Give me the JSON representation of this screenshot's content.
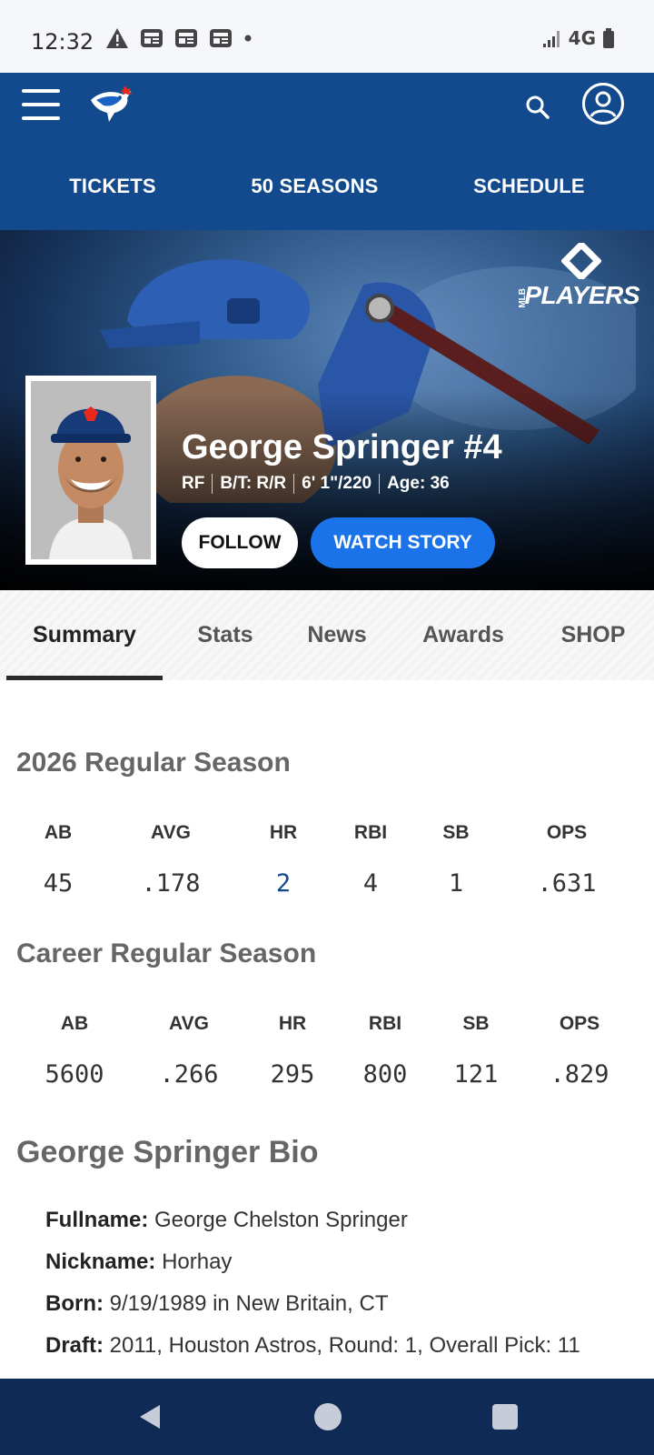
{
  "status_bar": {
    "time": "12:32",
    "network": "4G"
  },
  "header": {
    "nav": [
      {
        "label": "TICKETS"
      },
      {
        "label": "50 SEASONS"
      },
      {
        "label": "SCHEDULE"
      }
    ],
    "brand_color": "#134a8e"
  },
  "hero": {
    "badge_text": "PLAYERS",
    "badge_small": "MLB",
    "player_name": "George Springer #4",
    "meta": [
      "RF",
      "B/T: R/R",
      "6' 1\"/220",
      "Age: 36"
    ],
    "follow_label": "FOLLOW",
    "watch_label": "WATCH STORY"
  },
  "tabs": [
    {
      "label": "Summary",
      "active": true
    },
    {
      "label": "Stats"
    },
    {
      "label": "News"
    },
    {
      "label": "Awards"
    },
    {
      "label": "SHOP"
    }
  ],
  "season": {
    "title": "2026 Regular Season",
    "columns": [
      "AB",
      "AVG",
      "HR",
      "RBI",
      "SB",
      "OPS"
    ],
    "values": [
      "45",
      ".178",
      "2",
      "4",
      "1",
      ".631"
    ]
  },
  "career": {
    "title": "Career Regular Season",
    "columns": [
      "AB",
      "AVG",
      "HR",
      "RBI",
      "SB",
      "OPS"
    ],
    "values": [
      "5600",
      ".266",
      "295",
      "800",
      "121",
      ".829"
    ]
  },
  "bio": {
    "title": "George Springer Bio",
    "items": [
      {
        "label": "Fullname:",
        "value": "George Chelston Springer"
      },
      {
        "label": "Nickname:",
        "value": "Horhay"
      },
      {
        "label": "Born:",
        "value": "9/19/1989 in New Britain, CT"
      },
      {
        "label": "Draft:",
        "value": "2011, Houston Astros, Round: 1, Overall Pick: 11"
      }
    ]
  }
}
